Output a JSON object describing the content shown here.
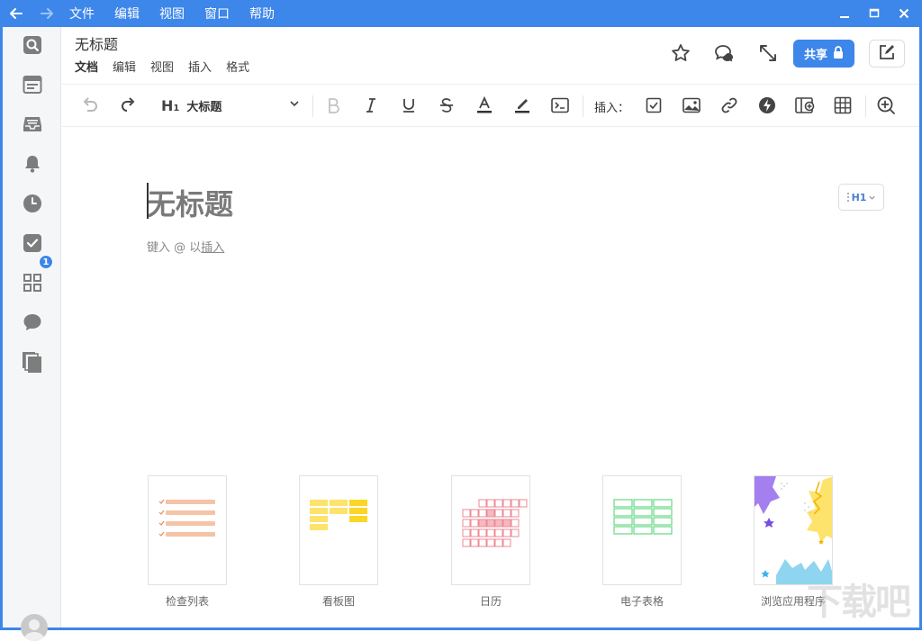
{
  "titlebar": {
    "menu": [
      "文件",
      "编辑",
      "视图",
      "窗口",
      "帮助"
    ],
    "bg_color": "#3d86ea"
  },
  "sidebar": {
    "items": [
      {
        "icon": "search-icon"
      },
      {
        "icon": "window-icon"
      },
      {
        "icon": "inbox-icon"
      },
      {
        "icon": "bell-icon"
      },
      {
        "icon": "clock-icon"
      },
      {
        "icon": "task-check-icon",
        "badge": "1"
      },
      {
        "icon": "apps-grid-icon"
      },
      {
        "icon": "chat-icon"
      },
      {
        "icon": "documents-icon"
      }
    ]
  },
  "header": {
    "doc_title": "无标题",
    "tabs": [
      "文档",
      "编辑",
      "视图",
      "插入",
      "格式"
    ],
    "share_label": "共享"
  },
  "toolbar": {
    "heading_label": "大标题",
    "heading_prefix": "H",
    "heading_sub": "1",
    "insert_label": "插入："
  },
  "editor": {
    "title_placeholder": "无标题",
    "hint_prefix": "键入 @ 以",
    "hint_link": "插入",
    "h1_button": "H1"
  },
  "templates": [
    {
      "label": "检查列表",
      "accent": "#f5c3a6"
    },
    {
      "label": "看板图",
      "accent": "#fde36c"
    },
    {
      "label": "日历",
      "accent": "#ec8a96"
    },
    {
      "label": "电子表格",
      "accent": "#67d985"
    },
    {
      "label": "浏览应用程序",
      "accent": "#a47ff0"
    }
  ],
  "watermark": "下载吧"
}
